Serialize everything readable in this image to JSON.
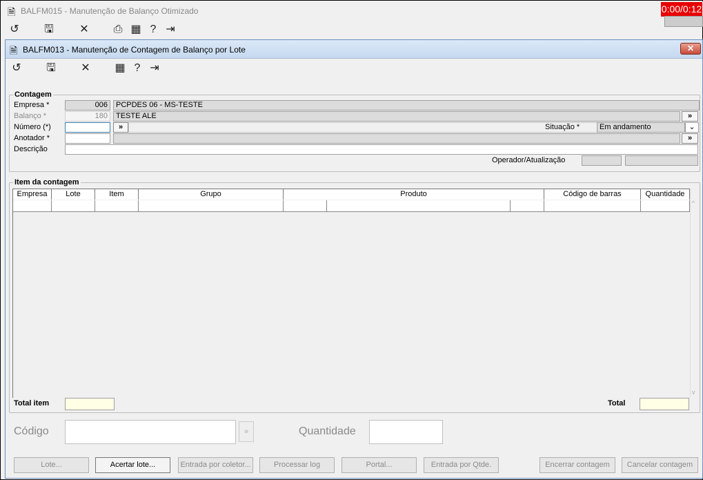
{
  "outer_window": {
    "title": "BALFM015 - Manutenção de Balanço Otimizado",
    "timer": "0:00/0:12"
  },
  "inner_window": {
    "title": "BALFM013 - Manutenção de Contagem de Balanço por Lote",
    "close_glyph": "✕"
  },
  "toolbar_icons": [
    "undo-icon",
    "save-icon",
    "close-icon",
    "print-icon",
    "calendar-icon",
    "help-icon",
    "exit-icon"
  ],
  "contagem": {
    "legend": "Contagem",
    "empresa_label": "Empresa *",
    "empresa_code": "006",
    "empresa_name": "PCPDES 06 - MS-TESTE",
    "balanco_label": "Balanço *",
    "balanco_code": "180",
    "balanco_name": "TESTE ALE",
    "numero_label": "Número (*)",
    "numero_value": "",
    "situacao_label": "Situação *",
    "situacao_value": "Em andamento",
    "anotador_label": "Anotador *",
    "anotador_value": "",
    "descricao_label": "Descrição",
    "descricao_value": "",
    "operador_label": "Operador/Atualização",
    "lookup_glyph": "»"
  },
  "item_contagem": {
    "legend": "Item da contagem",
    "columns": [
      "Empresa",
      "Lote",
      "Item",
      "Grupo",
      "Produto",
      "Código de barras",
      "Quantidade"
    ],
    "total_item_label": "Total item",
    "total_label": "Total"
  },
  "entry": {
    "codigo_label": "Código",
    "quantidade_label": "Quantidade"
  },
  "buttons": {
    "lote": "Lote...",
    "acertar_lote": "Acertar lote...",
    "entrada_coletor": "Entrada por coletor...",
    "processar_log": "Processar log",
    "portal": "Portal...",
    "entrada_qtde": "Entrada por Qtde.",
    "encerrar": "Encerrar contagem",
    "cancelar": "Cancelar contagem"
  },
  "colors": {
    "accent_title": "#c5d9ef",
    "timer_bg": "#e80000",
    "total_field_bg": "#ffffe6"
  }
}
